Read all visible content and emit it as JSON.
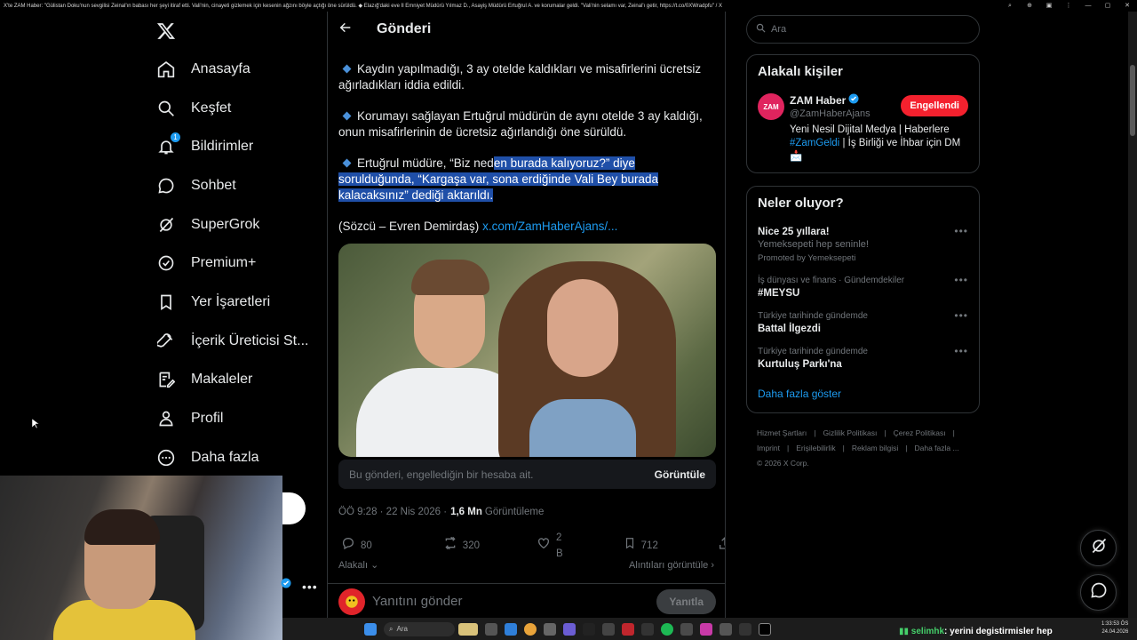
{
  "window": {
    "title": "X'te ZAM Haber: \"Gülistan Doku'nun sevgilisi Zeinal'ın babası her şeyi itiraf etti. Vali'nin, cinayeti gizlemek için kesenin ağzını böyle açtığı öne sürüldü. ◆ Elazığ'daki eve İl Emniyet Müdürü Yılmaz D., Asayiş Müdürü Ertuğrul A. ve korumalar geldi. \"Vali'nin selamı var, Zeinal'ı getir, https://t.co/0XWradpfu\" / X"
  },
  "nav": {
    "items": [
      {
        "label": "Anasayfa"
      },
      {
        "label": "Keşfet"
      },
      {
        "label": "Bildirimler",
        "badge": "1"
      },
      {
        "label": "Sohbet"
      },
      {
        "label": "SuperGrok"
      },
      {
        "label": "Premium+"
      },
      {
        "label": "Yer İşaretleri"
      },
      {
        "label": "İçerik Üreticisi St..."
      },
      {
        "label": "Makaleler"
      },
      {
        "label": "Profil"
      },
      {
        "label": "Daha fazla"
      }
    ]
  },
  "main": {
    "header_title": "Gönderi",
    "paragraphs": [
      "Kaydın yapılmadığı, 3 ay otelde kaldıkları ve misafirlerini ücretsiz ağırladıkları iddia edildi.",
      "Korumayı sağlayan Ertuğrul müdürün de aynı otelde 3 ay kaldığı, onun misafirlerinin de ücretsiz ağırlandığı öne sürüldü."
    ],
    "para3_plain": "Ertuğrul müdüre, “Biz ned",
    "para3_highlight": "en burada kalıyoruz?” diye sorulduğunda, “Kargaşa var, sona erdiğinde Vali Bey burada kalacaksınız” dediği aktarıldı.",
    "source_text": "(Sözcü – Evren Demirdaş) ",
    "source_link": "x.com/ZamHaberAjans/...",
    "blocked_msg": "Bu gönderi, engellediğin bir hesaba ait.",
    "blocked_btn": "Görüntüle",
    "time": "ÖÖ 9:28 · 22 Nis 2026 · ",
    "views_count": "1,6 Mn",
    "views_label": "Görüntüleme",
    "replies": "80",
    "reposts": "320",
    "likes": "2 B",
    "bookmarks": "712",
    "relevant": "Alakalı",
    "quotes": "Alıntıları görüntüle",
    "reply_placeholder": "Yanıtını gönder",
    "reply_button": "Yanıtla"
  },
  "right": {
    "search_placeholder": "Ara",
    "related_title": "Alakalı kişiler",
    "person": {
      "avatar_text": "ZAM",
      "name": "ZAM Haber",
      "handle": "@ZamHaberAjans",
      "button": "Engellendi",
      "bio1": "Yeni Nesil Dijital Medya | Haberlere ",
      "bio_tag": "#ZamGeldi",
      "bio2": " | İş Birliği ve İhbar için DM ",
      "bio3": "📩"
    },
    "whats_title": "Neler oluyor?",
    "trends": [
      {
        "name": "Nice 25 yıllara!",
        "sub": "Yemeksepeti hep seninle!",
        "promo": "Promoted by Yemeksepeti"
      },
      {
        "cat": "İş dünyası ve finans · Gündemdekiler",
        "name": "#MEYSU"
      },
      {
        "cat": "Türkiye tarihinde gündemde",
        "name": "Battal İlgezdi"
      },
      {
        "cat": "Türkiye tarihinde gündemde",
        "name": "Kurtuluş Parkı'na"
      }
    ],
    "show_more": "Daha fazla göster",
    "footer": [
      "Hizmet Şartları",
      "|",
      "Gizlilik Politikası",
      "|",
      "Çerez Politikası",
      "|",
      "Imprint",
      "|",
      "Erişilebilirlik",
      "|",
      "Reklam bilgisi",
      "|",
      "Daha fazla ...",
      "© 2026 X Corp."
    ]
  },
  "taskbar": {
    "search": "Ara",
    "chat_user": "selimhk",
    "chat_msg": ": yerini degistirmisler hep",
    "time": "1:33:53 ÖS",
    "date": "24.04.2026"
  },
  "colors": {
    "accent": "#1d9bf0",
    "highlight": "#1f4fa8",
    "block": "#f4212e"
  }
}
